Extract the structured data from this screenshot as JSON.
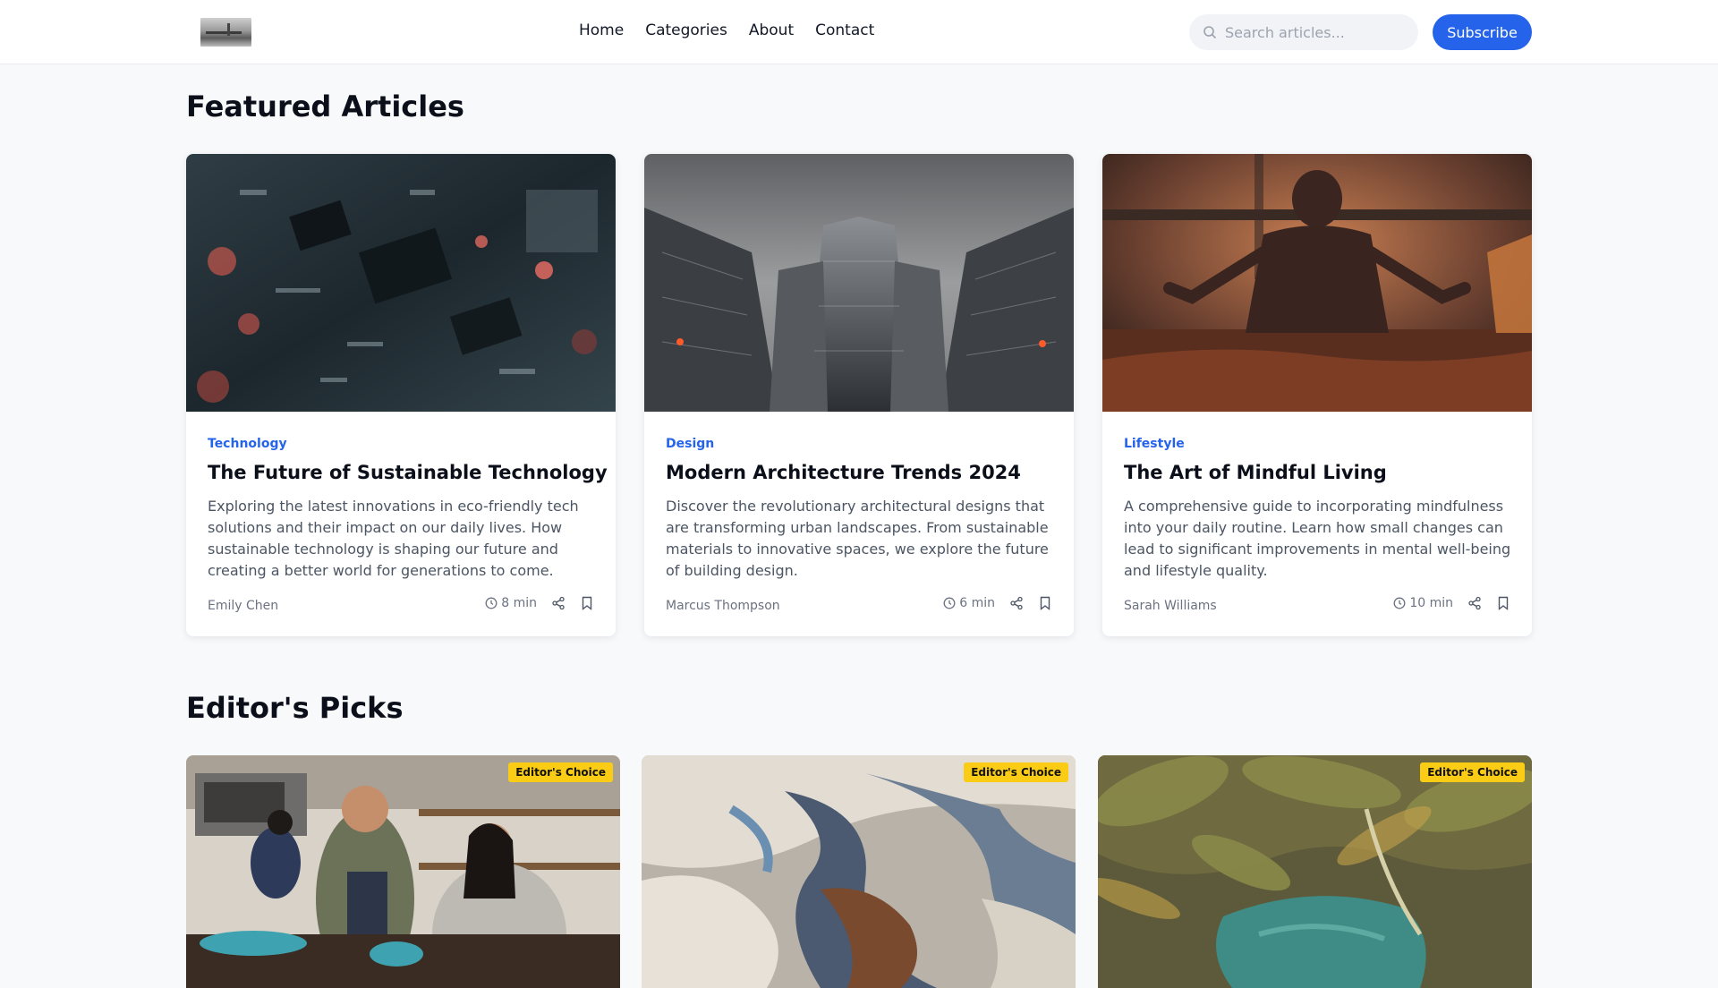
{
  "header": {
    "logo_icon": "logo-image",
    "nav": [
      "Home",
      "Categories",
      "About",
      "Contact"
    ],
    "search_placeholder": "Search articles...",
    "search_value": "",
    "subscribe_label": "Subscribe",
    "accent_color": "#2563eb"
  },
  "featured": {
    "title": "Featured Articles",
    "articles": [
      {
        "category": "Technology",
        "title": "The Future of Sustainable Technology",
        "description": "Exploring the latest innovations in eco-friendly tech solutions and their impact on our daily lives. How sustainable technology is shaping our future and creating a better world for generations to come.",
        "author": "Emily Chen",
        "read_time": "8 min",
        "image": "circuit-board-photo"
      },
      {
        "category": "Design",
        "title": "Modern Architecture Trends 2024",
        "description": "Discover the revolutionary architectural designs that are transforming urban landscapes. From sustainable materials to innovative spaces, we explore the future of building design.",
        "author": "Marcus Thompson",
        "read_time": "6 min",
        "image": "skyscrapers-photo"
      },
      {
        "category": "Lifestyle",
        "title": "The Art of Mindful Living",
        "description": "A comprehensive guide to incorporating mindfulness into your daily routine. Learn how small changes can lead to significant improvements in mental well-being and lifestyle quality.",
        "author": "Sarah Williams",
        "read_time": "10 min",
        "image": "meditation-photo"
      }
    ]
  },
  "editors_picks": {
    "title": "Editor's Picks",
    "badge": "Editor's Choice",
    "badge_color": "#facc15",
    "items": [
      {
        "image": "cooking-photo"
      },
      {
        "image": "abstract-swirl-photo"
      },
      {
        "image": "tropical-lagoon-photo"
      }
    ]
  }
}
